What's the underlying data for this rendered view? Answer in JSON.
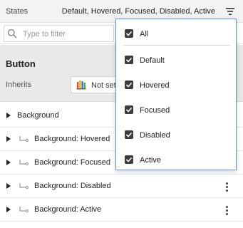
{
  "states": {
    "label": "States",
    "value": "Default, Hovered, Focused, Disabled, Active"
  },
  "filter": {
    "placeholder": "Type to filter",
    "value": ""
  },
  "section": {
    "title": "Button",
    "inherits_label": "Inherits",
    "inherits_value": "Not set"
  },
  "properties": [
    {
      "label": "Background",
      "has_link_icon": false,
      "has_menu": false
    },
    {
      "label": "Background: Hovered",
      "has_link_icon": true,
      "has_menu": false
    },
    {
      "label": "Background: Focused",
      "has_link_icon": true,
      "has_menu": false
    },
    {
      "label": "Background: Disabled",
      "has_link_icon": true,
      "has_menu": true
    },
    {
      "label": "Background: Active",
      "has_link_icon": true,
      "has_menu": true
    }
  ],
  "dropdown": {
    "items": [
      {
        "label": "All",
        "checked": true
      },
      {
        "label": "Default",
        "checked": true
      },
      {
        "label": "Hovered",
        "checked": true
      },
      {
        "label": "Focused",
        "checked": true
      },
      {
        "label": "Disabled",
        "checked": true
      },
      {
        "label": "Active",
        "checked": true
      }
    ]
  },
  "icons": {
    "filter": "filter-lines-icon",
    "search": "search-icon",
    "inherits": "palette-icon",
    "link": "link-arrow-icon",
    "menu": "more-vertical-icon",
    "checkbox": "checkmark-icon"
  },
  "colors": {
    "dropdown_border": "#5b9bd5",
    "section_bg": "#e9e9e9",
    "checkbox_fill": "#3c3c3c"
  }
}
